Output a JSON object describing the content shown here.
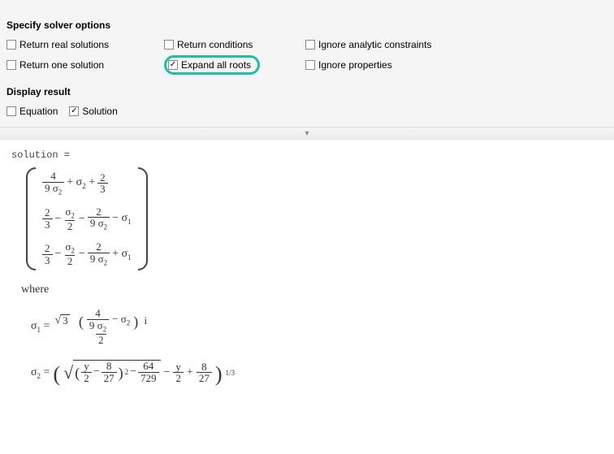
{
  "sections": {
    "solver_title": "Specify solver options",
    "display_title": "Display result"
  },
  "solver_options": {
    "col1": {
      "real": "Return real solutions",
      "one": "Return one solution"
    },
    "col2": {
      "conditions": "Return conditions",
      "expand": "Expand all roots"
    },
    "col3": {
      "analytic": "Ignore analytic constraints",
      "properties": "Ignore properties"
    },
    "checked": {
      "expand": true
    }
  },
  "display_options": {
    "equation": "Equation",
    "solution": "Solution",
    "checked": {
      "solution": true
    }
  },
  "results": {
    "assign_line": "solution =",
    "where_label": "where",
    "matrix_rows": [
      {
        "terms": "4/(9 σ₂) + σ₂ + 2/3"
      },
      {
        "terms": "2/3 − σ₂/2 − 2/(9 σ₂) − σ₁"
      },
      {
        "terms": "2/3 − σ₂/2 − 2/(9 σ₂) + σ₁"
      }
    ],
    "sigma1": "σ₁ = ( √3 · ( 4/(9 σ₂) − σ₂ ) · i ) / 2",
    "sigma2": "σ₂ = ( √( (y/2 − 8/27)² − 64/729 ) − y/2 + 8/27 )^(1/3)"
  }
}
